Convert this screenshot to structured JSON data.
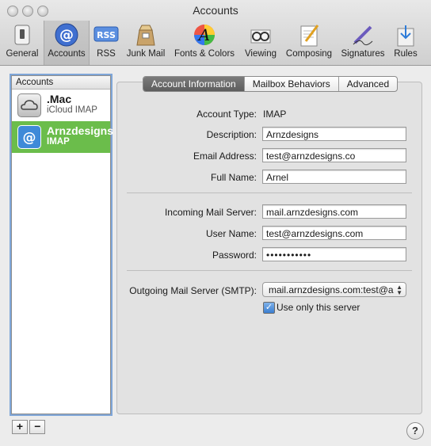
{
  "window": {
    "title": "Accounts"
  },
  "toolbar": {
    "items": [
      {
        "label": "General",
        "icon": "general-switch-icon"
      },
      {
        "label": "Accounts",
        "icon": "at-sign-icon"
      },
      {
        "label": "RSS",
        "icon": "rss-icon"
      },
      {
        "label": "Junk Mail",
        "icon": "junk-mail-bag-icon"
      },
      {
        "label": "Fonts & Colors",
        "icon": "fonts-colors-icon"
      },
      {
        "label": "Viewing",
        "icon": "glasses-icon"
      },
      {
        "label": "Composing",
        "icon": "pencil-paper-icon"
      },
      {
        "label": "Signatures",
        "icon": "pen-signature-icon"
      },
      {
        "label": "Rules",
        "icon": "rules-envelope-icon"
      }
    ],
    "selected": "Accounts"
  },
  "sidebar": {
    "header": "Accounts",
    "accounts": [
      {
        "name": ".Mac",
        "type": "iCloud IMAP",
        "icon": "cloud-icon"
      },
      {
        "name": "Arnzdesigns",
        "type": "IMAP",
        "icon": "at-sign-icon"
      }
    ],
    "add_label": "+",
    "remove_label": "−"
  },
  "tabs": [
    {
      "label": "Account Information",
      "active": true
    },
    {
      "label": "Mailbox Behaviors",
      "active": false
    },
    {
      "label": "Advanced",
      "active": false
    }
  ],
  "form": {
    "account_type_label": "Account Type:",
    "account_type_value": "IMAP",
    "description_label": "Description:",
    "description_value": "Arnzdesigns",
    "email_label": "Email Address:",
    "email_value": "test@arnzdesigns.co",
    "fullname_label": "Full Name:",
    "fullname_value": "Arnel",
    "incoming_label": "Incoming Mail Server:",
    "incoming_value": "mail.arnzdesigns.com",
    "username_label": "User Name:",
    "username_value": "test@arnzdesigns.com",
    "password_label": "Password:",
    "password_value": "•••••••••••",
    "outgoing_label": "Outgoing Mail Server (SMTP):",
    "outgoing_value": "mail.arnzdesigns.com:test@a",
    "use_only_label": "Use only this server",
    "use_only_checked": true
  },
  "help_label": "?",
  "colors": {
    "selection_green": "#6bbd4b",
    "focus_ring": "#7fa6d8"
  }
}
